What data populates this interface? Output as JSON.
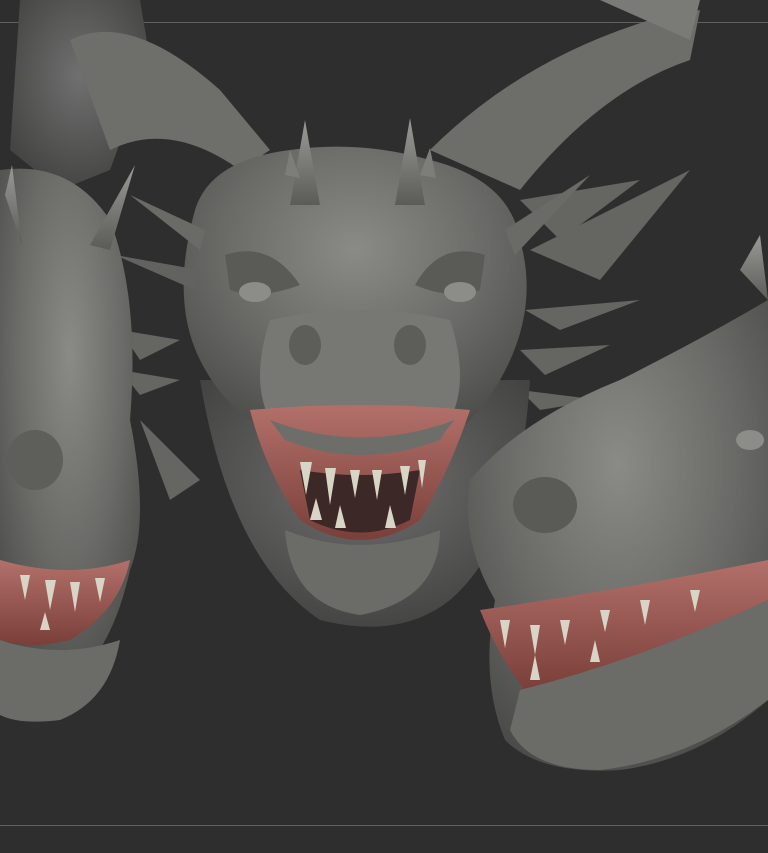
{
  "viewport": {
    "background_color": "#2e2e2e",
    "model_color": "#6f6f6c",
    "mouth_color": "#a9675f",
    "teeth_color": "#d8d4c6"
  },
  "model": {
    "heads": [
      "left-head",
      "center-head",
      "right-head"
    ]
  }
}
